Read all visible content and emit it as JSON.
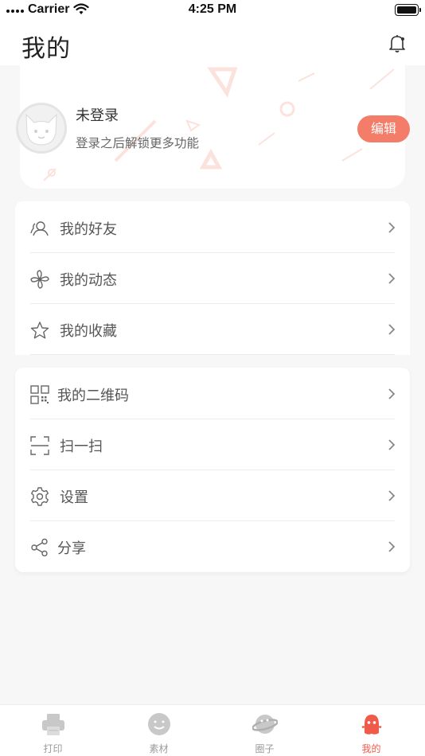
{
  "status_bar": {
    "carrier": "Carrier",
    "time": "4:25 PM"
  },
  "header": {
    "title": "我的",
    "notification_icon": "bell-icon"
  },
  "profile": {
    "name": "未登录",
    "subtitle": "登录之后解锁更多功能",
    "edit_label": "编辑",
    "avatar_icon": "cat-avatar-icon",
    "accent_color": "#f47d6a"
  },
  "menu_group_1": [
    {
      "label": "我的好友",
      "icon": "friends-icon"
    },
    {
      "label": "我的动态",
      "icon": "pinwheel-icon"
    },
    {
      "label": "我的收藏",
      "icon": "star-icon"
    }
  ],
  "menu_group_2": [
    {
      "label": "我的二维码",
      "icon": "qrcode-icon"
    },
    {
      "label": "扫一扫",
      "icon": "scan-icon"
    },
    {
      "label": "设置",
      "icon": "gear-icon"
    },
    {
      "label": "分享",
      "icon": "share-icon"
    }
  ],
  "tabs": [
    {
      "label": "打印",
      "icon": "printer-icon",
      "active": false
    },
    {
      "label": "素材",
      "icon": "smiley-icon",
      "active": false
    },
    {
      "label": "圈子",
      "icon": "planet-icon",
      "active": false
    },
    {
      "label": "我的",
      "icon": "ghost-icon",
      "active": true
    }
  ],
  "colors": {
    "active_tab": "#f05a4a",
    "inactive_tab": "#9b9b9b"
  }
}
